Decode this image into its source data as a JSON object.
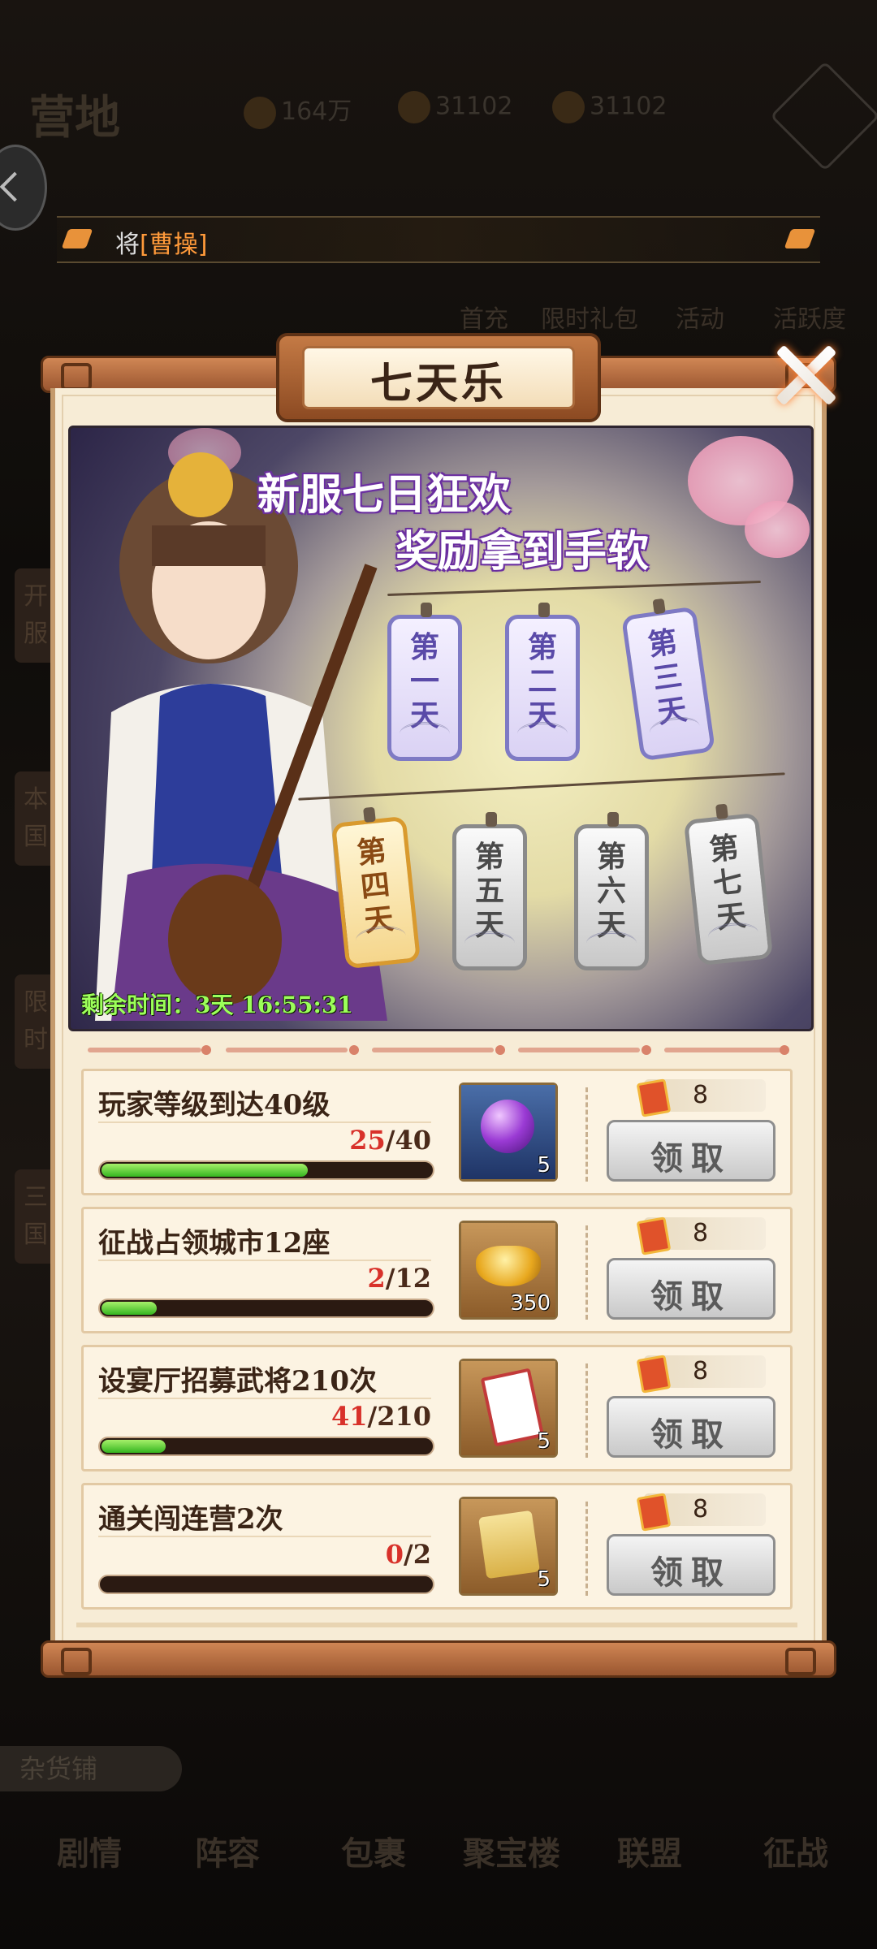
{
  "background": {
    "title": "营地",
    "resources": [
      {
        "icon": "coin-icon",
        "value": "164万"
      },
      {
        "icon": "food-icon",
        "value": "31102"
      },
      {
        "icon": "wood-icon",
        "value": "31102"
      }
    ],
    "top_menu": [
      "首充",
      "限时礼包",
      "活动",
      "活跃度"
    ],
    "side_tags": [
      "开服",
      "本国",
      "限时",
      "三国"
    ],
    "shop_label": "杂货铺",
    "bottom_nav": [
      "剧情",
      "阵容",
      "包裹",
      "聚宝楼",
      "联盟",
      "征战"
    ]
  },
  "notice": {
    "prefix": "将",
    "name": "[曹操]"
  },
  "panel": {
    "title": "七天乐"
  },
  "banner": {
    "headline_1": "新服七日狂欢",
    "headline_2": "奖励拿到手软",
    "days": [
      {
        "label": "第一天",
        "state": "unlocked"
      },
      {
        "label": "第二天",
        "state": "unlocked"
      },
      {
        "label": "第三天",
        "state": "unlocked"
      },
      {
        "label": "第四天",
        "state": "current"
      },
      {
        "label": "第五天",
        "state": "locked"
      },
      {
        "label": "第六天",
        "state": "locked"
      },
      {
        "label": "第七天",
        "state": "locked"
      }
    ],
    "timer": "剩余时间：3天 16:55:31"
  },
  "tasks": [
    {
      "desc": "玩家等级到达40级",
      "current": "25",
      "target": "/40",
      "progress": 0.625,
      "item_icon": "purple-orb-icon",
      "item_qty": "5",
      "reward": "8",
      "button": "领取"
    },
    {
      "desc": "征战占领城市12座",
      "current": "2",
      "target": "/12",
      "progress": 0.167,
      "item_icon": "gold-ingot-icon",
      "item_qty": "350",
      "reward": "8",
      "button": "领取"
    },
    {
      "desc": "设宴厅招募武将210次",
      "current": "41",
      "target": "/210",
      "progress": 0.195,
      "item_icon": "invitation-card-icon",
      "item_qty": "5",
      "reward": "8",
      "button": "领取"
    },
    {
      "desc": "通关闯连营2次",
      "current": "0",
      "target": "/2",
      "progress": 0,
      "item_icon": "ticket-scroll-icon",
      "item_qty": "5",
      "reward": "8",
      "button": "领取"
    }
  ],
  "colors": {
    "accent": "#ff9a3a",
    "progress": "#34b520",
    "count_current": "#d8312a",
    "timer": "#9cff5a"
  }
}
